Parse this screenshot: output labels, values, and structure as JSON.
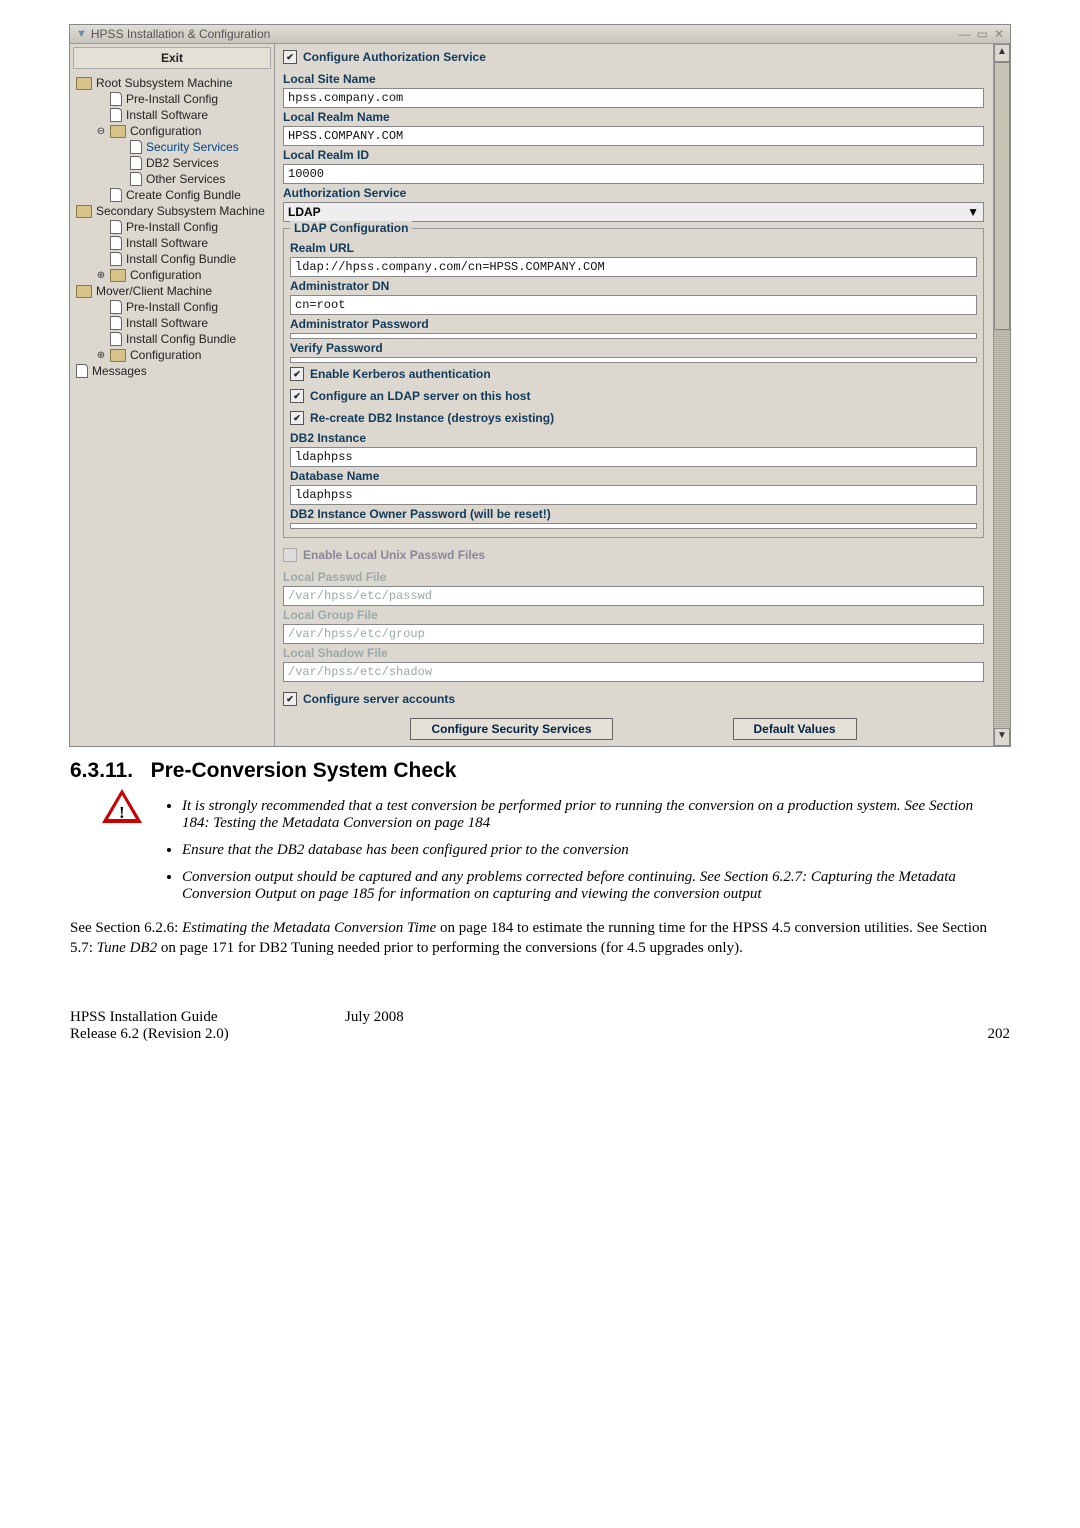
{
  "window": {
    "title": "HPSS Installation & Configuration"
  },
  "tree": {
    "exit": "Exit",
    "items": [
      {
        "label": "Root Subsystem Machine",
        "type": "folder",
        "indent": 0
      },
      {
        "label": "Pre-Install Config",
        "type": "leaf",
        "indent": 1
      },
      {
        "label": "Install Software",
        "type": "leaf",
        "indent": 1
      },
      {
        "label": "Configuration",
        "type": "folder",
        "indent": 1,
        "toggle": "−"
      },
      {
        "label": "Security Services",
        "type": "leaf",
        "indent": 2,
        "selected": true
      },
      {
        "label": "DB2 Services",
        "type": "leaf",
        "indent": 2
      },
      {
        "label": "Other Services",
        "type": "leaf",
        "indent": 2
      },
      {
        "label": "Create Config Bundle",
        "type": "leaf",
        "indent": 1
      },
      {
        "label": "Secondary Subsystem Machine",
        "type": "folder",
        "indent": 0
      },
      {
        "label": "Pre-Install Config",
        "type": "leaf",
        "indent": 1
      },
      {
        "label": "Install Software",
        "type": "leaf",
        "indent": 1
      },
      {
        "label": "Install Config Bundle",
        "type": "leaf",
        "indent": 1
      },
      {
        "label": "Configuration",
        "type": "folder",
        "indent": 1,
        "toggle": "+"
      },
      {
        "label": "Mover/Client Machine",
        "type": "folder",
        "indent": 0
      },
      {
        "label": "Pre-Install Config",
        "type": "leaf",
        "indent": 1
      },
      {
        "label": "Install Software",
        "type": "leaf",
        "indent": 1
      },
      {
        "label": "Install Config Bundle",
        "type": "leaf",
        "indent": 1
      },
      {
        "label": "Configuration",
        "type": "folder",
        "indent": 1,
        "toggle": "+"
      },
      {
        "label": "Messages",
        "type": "leaf",
        "indent": 0
      }
    ]
  },
  "panel": {
    "configure_auth_service": "Configure Authorization Service",
    "local_site_name_label": "Local Site Name",
    "local_site_name": "hpss.company.com",
    "local_realm_name_label": "Local Realm Name",
    "local_realm_name": "HPSS.COMPANY.COM",
    "local_realm_id_label": "Local Realm ID",
    "local_realm_id": "10000",
    "auth_service_label": "Authorization Service",
    "auth_service_value": "LDAP",
    "ldap_cfg_title": "LDAP Configuration",
    "realm_url_label": "Realm URL",
    "realm_url": "ldap://hpss.company.com/cn=HPSS.COMPANY.COM",
    "admin_dn_label": "Administrator DN",
    "admin_dn": "cn=root",
    "admin_pw_label": "Administrator Password",
    "admin_pw": "",
    "verify_pw_label": "Verify Password",
    "verify_pw": "",
    "enable_kerberos": "Enable Kerberos authentication",
    "configure_ldap_host": "Configure an LDAP server on this host",
    "recreate_db2": "Re-create DB2 Instance (destroys existing)",
    "db2_instance_label": "DB2 Instance",
    "db2_instance": "ldaphpss",
    "database_name_label": "Database Name",
    "database_name": "ldaphpss",
    "db2_owner_pw_label": "DB2 Instance Owner Password (will be reset!)",
    "db2_owner_pw": "",
    "enable_local_passwd": "Enable Local Unix Passwd Files",
    "local_passwd_file_label": "Local Passwd File",
    "local_passwd_file": "/var/hpss/etc/passwd",
    "local_group_file_label": "Local Group File",
    "local_group_file": "/var/hpss/etc/group",
    "local_shadow_file_label": "Local Shadow File",
    "local_shadow_file": "/var/hpss/etc/shadow",
    "configure_server_accounts": "Configure server accounts",
    "btn_configure": "Configure Security Services",
    "btn_defaults": "Default Values"
  },
  "doc": {
    "section_number": "6.3.11.",
    "section_title": "Pre-Conversion System Check",
    "bullet1": "It is strongly recommended that a test conversion be performed prior to running the conversion on a production system.  See Section 184:  Testing the Metadata Conversion on page 184",
    "bullet2": "Ensure that the DB2 database has been configured prior to the conversion",
    "bullet3": "Conversion output should be captured and any problems corrected before continuing. See Section 6.2.7: Capturing the Metadata Conversion Output on page 185 for information on capturing and viewing the conversion output",
    "para1_a": "See Section 6.2.6: ",
    "para1_i1": "Estimating the Metadata Conversion Time",
    "para1_b": "  on page 184 to estimate the running time for the HPSS 4.5 conversion utilities.  See Section 5.7: ",
    "para1_i2": "Tune DB2",
    "para1_c": " on page 171 for DB2 Tuning needed prior to performing the conversions (for 4.5 upgrades only).",
    "footer_left1": "HPSS Installation Guide",
    "footer_center": "July 2008",
    "footer_left2": "Release 6.2 (Revision 2.0)",
    "footer_right": "202"
  }
}
